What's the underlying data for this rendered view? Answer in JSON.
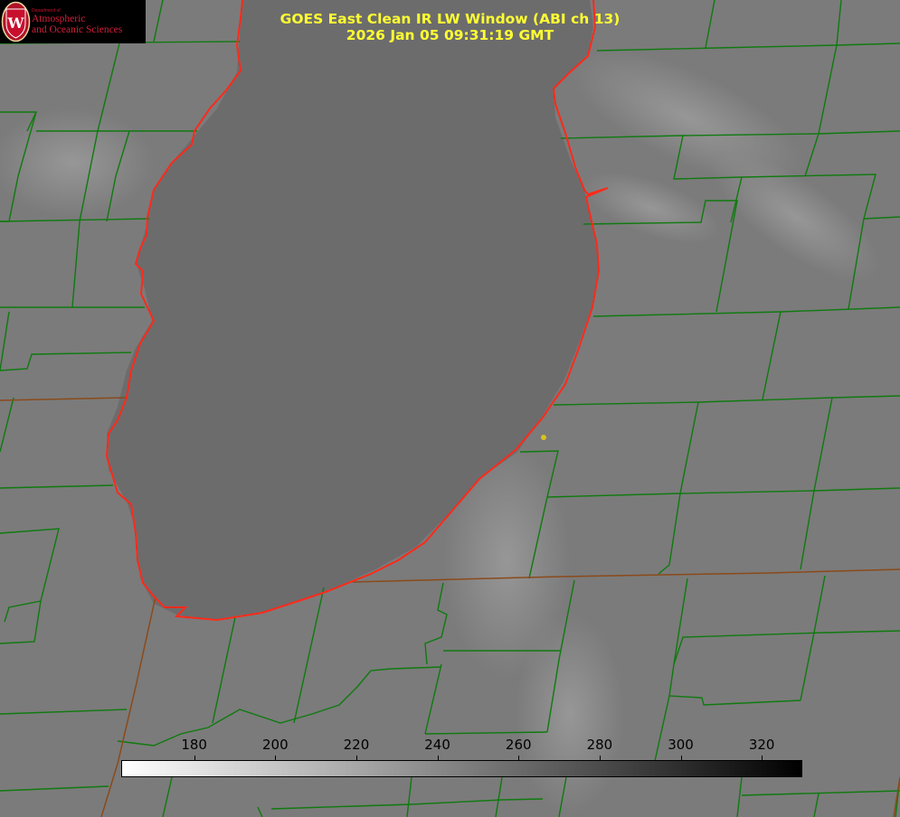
{
  "title": {
    "line1": "GOES East Clean IR LW Window (ABI ch 13)",
    "line2": "2026 Jan 05 09:31:19 GMT"
  },
  "logo": {
    "department": "Department of",
    "name_line1": "Atmospheric",
    "name_line2": "and Oceanic Sciences"
  },
  "colorbar": {
    "range": [
      162,
      330
    ],
    "ticks": [
      {
        "value": 180,
        "label": "180"
      },
      {
        "value": 200,
        "label": "200"
      },
      {
        "value": 220,
        "label": "220"
      },
      {
        "value": 240,
        "label": "240"
      },
      {
        "value": 260,
        "label": "260"
      },
      {
        "value": 280,
        "label": "280"
      },
      {
        "value": 300,
        "label": "300"
      },
      {
        "value": 320,
        "label": "320"
      }
    ],
    "low_color": "#ffffff",
    "high_color": "#000000"
  },
  "colors": {
    "background": "#7b7b7b",
    "lake": "#6b6b6b",
    "shoreline": "#ff2a1a",
    "county_lines": "#0f7a0f",
    "state_lines": "#8b4a1a",
    "title": "#ffff33",
    "marker": "#d9c21c"
  }
}
